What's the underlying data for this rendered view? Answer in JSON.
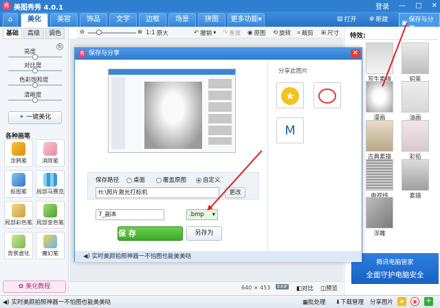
{
  "app": {
    "title": "美图秀秀 4.0.1",
    "logo_char": "秀",
    "login": "登录"
  },
  "tabs": [
    "美化",
    "美容",
    "饰品",
    "文字",
    "边框",
    "场景",
    "拼图",
    "更多功能▾"
  ],
  "right_tools": {
    "open": "打开",
    "new": "新建",
    "save": "保存与分享"
  },
  "toolbar": {
    "zoom": "1:1",
    "original": "原大",
    "undo": "撤销",
    "redo": "重做",
    "orig_image": "原图",
    "rotate": "旋转",
    "crop": "裁剪",
    "size": "尺寸"
  },
  "left": {
    "tabs": [
      "基础",
      "高级",
      "调色"
    ],
    "adjust": [
      "亮度",
      "对比度",
      "色彩饱和度",
      "清晰度"
    ],
    "one_key": "一键美化",
    "section": "各种画笔",
    "tools": [
      "涂鸦笔",
      "消除笔",
      "抠图笔",
      "局部马赛克",
      "局部彩色笔",
      "局部变色笔",
      "背景虚化",
      "魔幻笔"
    ],
    "tutorial": "美化教程"
  },
  "right": {
    "effects_title": "特效:",
    "effects": [
      "写生素描",
      "铅笔",
      "漫画",
      "油画",
      "古典素描",
      "彩铅",
      "电视线",
      "素描",
      "浮雕"
    ],
    "ad_line1": "腾讯电脑管家",
    "ad_line2": "全面守护电脑安全"
  },
  "dialog": {
    "title": "保存与分享",
    "share_label": "分享此图片",
    "path_label": "保存路径",
    "options": [
      "桌面",
      "覆盖原图",
      "自定义"
    ],
    "selected_option": "自定义",
    "path": "H:\\照片激光打标机",
    "change_btn": "更改",
    "filename": "7_副本",
    "ext": ".bmp",
    "save_btn": "保 存",
    "save_as_btn": "另存为",
    "note": "实时美颜拍照神器一不怕图也能美美哒"
  },
  "bottom": {
    "dims": "640 × 453",
    "exif": "EXIF",
    "compare": "对比",
    "preview": "预览"
  },
  "status": {
    "tip": "实时美颜拍照神器一不怕图也能美美哒",
    "batch": "批处理",
    "download": "下载管理",
    "share": "分享图片"
  },
  "colors": {
    "accent": "#2f7fd0",
    "save_green": "#3ea82a",
    "annotation": "#e02020"
  }
}
